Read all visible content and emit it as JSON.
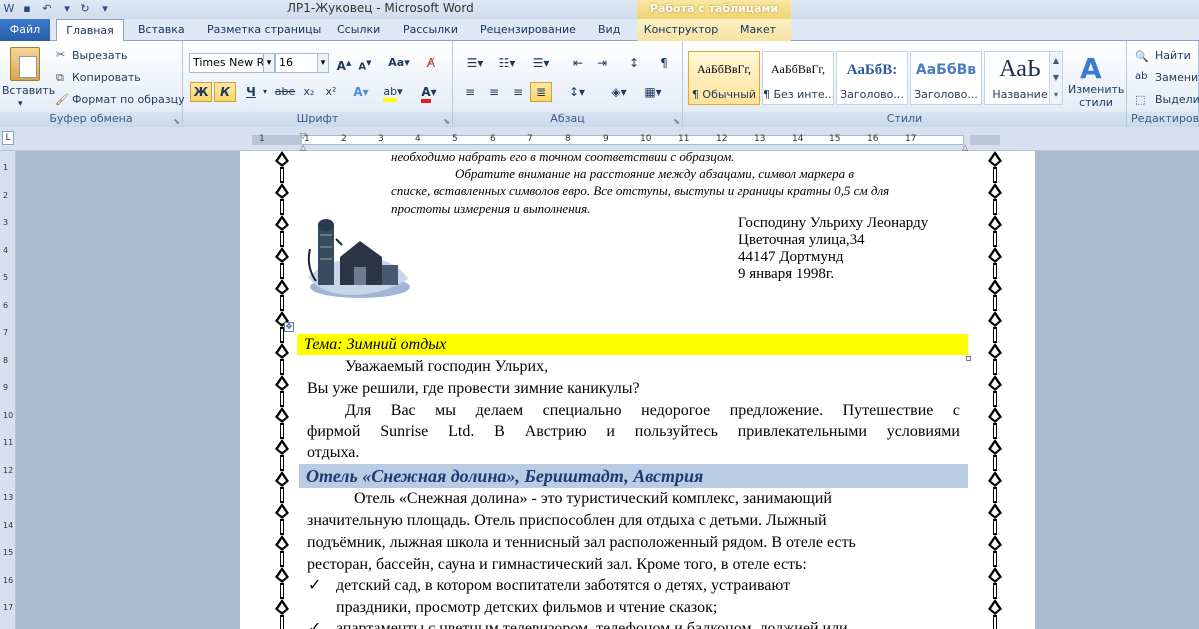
{
  "window": {
    "title": "ЛР1-Жуковец  -  Microsoft Word",
    "context_tab_group": "Работа с таблицами"
  },
  "tabs": [
    {
      "label": "Файл"
    },
    {
      "label": "Главная"
    },
    {
      "label": "Вставка"
    },
    {
      "label": "Разметка страницы"
    },
    {
      "label": "Ссылки"
    },
    {
      "label": "Рассылки"
    },
    {
      "label": "Рецензирование"
    },
    {
      "label": "Вид"
    },
    {
      "label": "Конструктор"
    },
    {
      "label": "Макет"
    }
  ],
  "clipboard": {
    "paste": "Вставить",
    "cut": "Вырезать",
    "copy": "Копировать",
    "format_painter": "Формат по образцу",
    "group_label": "Буфер обмена"
  },
  "font": {
    "family": "Times New Rc",
    "size": "16",
    "bold": "Ж",
    "italic": "К",
    "underline": "Ч",
    "strike": "abe",
    "subscript": "x₂",
    "superscript": "x²",
    "group_label": "Шрифт"
  },
  "paragraph": {
    "group_label": "Абзац"
  },
  "styles": {
    "group_label": "Стили",
    "items": [
      {
        "sample": "АаБбВвГг,",
        "name": "¶ Обычный"
      },
      {
        "sample": "АаБбВвГг,",
        "name": "¶ Без инте..."
      },
      {
        "sample": "АаБбВ:",
        "name": "Заголово..."
      },
      {
        "sample": "АаБбВв",
        "name": "Заголово..."
      },
      {
        "sample": "АаЬ",
        "name": "Название"
      }
    ],
    "change_styles": "Изменить стили"
  },
  "editing": {
    "group_label": "Редактирова",
    "find": "Найти",
    "replace": "Заменит",
    "select": "Выделит"
  },
  "ruler": {
    "labels": [
      "1",
      "1",
      "2",
      "3",
      "4",
      "5",
      "6",
      "7",
      "8",
      "9",
      "10",
      "11",
      "12",
      "13",
      "14",
      "15",
      "16",
      "17"
    ],
    "vlabels": [
      "1",
      "2",
      "3",
      "4",
      "5",
      "6",
      "7",
      "8",
      "9",
      "10",
      "11",
      "12",
      "13",
      "14",
      "15",
      "16",
      "17"
    ]
  },
  "document": {
    "top_line": "необходимо набрать его в точном соответствии с образцом.",
    "note_line1": "Обратите внимание на расстояние между абзацами, символ маркера в",
    "note_line2": "списке, вставленных символов евро. Все отступы, выступы и границы кратны 0,5 см для",
    "note_line3": "простоты измерения и выполнения.",
    "address": [
      "Господину Ульриху Леонарду",
      "Цветочная улица,34",
      "44147 Дортмунд",
      "9 января 1998г."
    ],
    "topic": "Тема: Зимний отдых",
    "greeting": "Уважаемый господин Ульрих,",
    "question": "Вы уже решили, где провести зимние каникулы?",
    "offer_l1": "Для Вас мы делаем специально недорогое предложение. Путешествие с",
    "offer_l2": "фирмой Sunrise Ltd. В Австрию и пользуйтесь привлекательными условиями",
    "offer_l3": "отдыха.",
    "hotel_heading": "Отель «Снежная долина», Бериштадт, Австрия",
    "hotel_l1": "Отель «Снежная долина» - это туристический комплекс, занимающий",
    "hotel_l2": "значительную площадь. Отель приспособлен для отдыха с детьми. Лыжный",
    "hotel_l3": "подъёмник, лыжная школа и теннисный зал расположенный рядом. В отеле есть",
    "hotel_l4": "ресторан, бассейн, сауна и гимнастический зал. Кроме того, в отеле есть:",
    "bullet1_l1": "детский сад, в котором воспитатели заботятся о детях, устраивают",
    "bullet1_l2": "праздники, просмотр детских фильмов и чтение сказок;",
    "bullet2_l1": "апартаменты с цветным телевизором, телефоном и балконом, лоджией или"
  }
}
